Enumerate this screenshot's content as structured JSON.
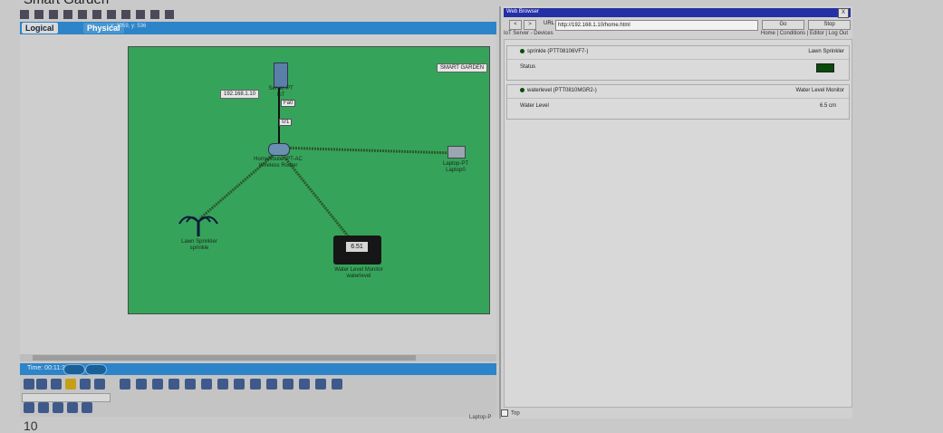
{
  "page_title": "Smart Garden",
  "packet_tracer": {
    "modes": {
      "logical": "Logical",
      "physical": "Physical"
    },
    "workspace_coords": "x: 1059, y: 536",
    "time": "Time: 00:11:35",
    "canvas_labels": {
      "smart_garden": "SMART GARDEN",
      "ip": "192.168.1.10",
      "server": "Server-PT\nIoT",
      "router": "HomeRouter-PT-AC\nWireless Router",
      "laptop": "Laptop-PT\nLaptop0",
      "sprinkler": "Lawn Sprinkler\nsprinkle",
      "water_monitor": "Water Level Monitor\nwaterlevel",
      "port_fa0": "Fa0",
      "port_0_1": "0/1",
      "water_display": "6.51"
    },
    "bottom_number": "10",
    "bottom_tiny": "Laptop-P"
  },
  "browser": {
    "window_title": "Web Browser",
    "close": "X",
    "nav_back": "<",
    "nav_forward": ">",
    "url_label": "URL",
    "url": "http://192.168.1.10/home.html",
    "go": "Go",
    "stop": "Stop",
    "page_name": "IoT Server - Devices",
    "links": {
      "home": "Home",
      "conditions": "Conditions",
      "editor": "Editor",
      "logout": "Log Out"
    },
    "devices": [
      {
        "name": "sprinkle (PTT08106VF7-)",
        "type": "Lawn Sprinkler",
        "row_label": "Status",
        "row_value": "",
        "status_color": "#0a4a0a"
      },
      {
        "name": "waterlevel (PTT0810MGR2-)",
        "type": "Water Level Monitor",
        "row_label": "Water Level",
        "row_value": "6.5 cm",
        "status_color": "#0c4a0c"
      }
    ],
    "top_checkbox_label": "Top"
  },
  "colors": {
    "canvas_green": "#36a35b",
    "accent_blue": "#2d84c8",
    "browser_title_blue": "#2430a6"
  }
}
